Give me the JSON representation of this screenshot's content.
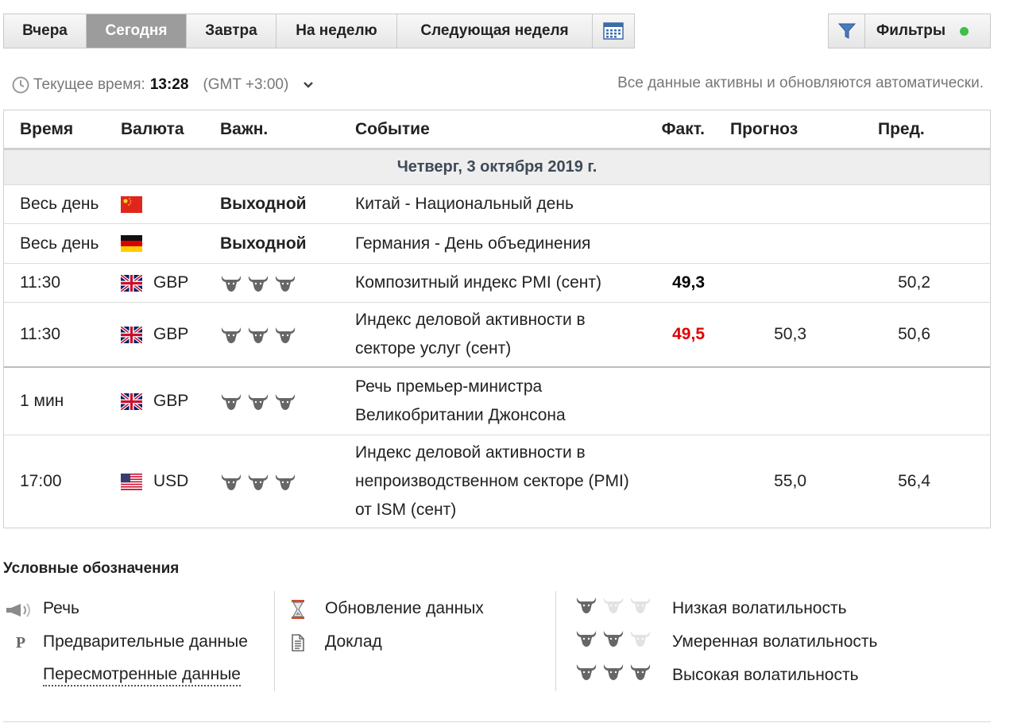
{
  "tabs": [
    {
      "label": "Вчера"
    },
    {
      "label": "Сегодня"
    },
    {
      "label": "Завтра"
    },
    {
      "label": "На неделю"
    },
    {
      "label": "Следующая неделя"
    }
  ],
  "active_tab": "Сегодня",
  "calendar_icon": "calendar-icon",
  "filters": {
    "label": "Фильтры",
    "icon": "funnel-icon",
    "status_color": "#3cc04a"
  },
  "current_time": {
    "label": "Текущее время:",
    "value": "13:28",
    "timezone": "(GMT +3:00)"
  },
  "auto_update_note": "Все данные активны и обновляются автоматически.",
  "table": {
    "headers": {
      "time": "Время",
      "currency": "Валюта",
      "importance": "Важн.",
      "event": "Событие",
      "actual": "Факт.",
      "forecast": "Прогноз",
      "previous": "Пред."
    },
    "day": "Четверг, 3 октября 2019 г.",
    "rows": [
      {
        "time": "Весь день",
        "flag": "china-flag",
        "currency": "",
        "importance_text": "Выходной",
        "event": "Китай - Национальный день",
        "actual": "",
        "forecast": "",
        "previous": ""
      },
      {
        "time": "Весь день",
        "flag": "germany-flag",
        "currency": "",
        "importance_text": "Выходной",
        "event": "Германия - День объединения",
        "actual": "",
        "forecast": "",
        "previous": ""
      },
      {
        "time": "11:30",
        "flag": "uk-flag",
        "currency": "GBP",
        "volatility": 3,
        "event": "Композитный индекс PMI (сент)",
        "actual": "49,3",
        "actual_color": "#000000",
        "forecast": "",
        "previous": "50,2"
      },
      {
        "time": "11:30",
        "flag": "uk-flag",
        "currency": "GBP",
        "volatility": 3,
        "event": "Индекс деловой активности в секторе услуг (сент)",
        "actual": "49,5",
        "actual_color": "#e00000",
        "forecast": "50,3",
        "previous": "50,6"
      },
      {
        "time": "1 мин",
        "flag": "uk-flag",
        "currency": "GBP",
        "volatility": 3,
        "event": "Речь премьер-министра Великобритании Джонсона",
        "actual": "",
        "forecast": "",
        "previous": ""
      },
      {
        "time": "17:00",
        "flag": "usa-flag",
        "currency": "USD",
        "volatility": 3,
        "event": "Индекс деловой активности в непроизводственном секторе (PMI) от ISM (сент)",
        "actual": "",
        "forecast": "55,0",
        "previous": "56,4"
      }
    ]
  },
  "legend": {
    "title": "Условные обозначения",
    "speech": "Речь",
    "preliminary": "Предварительные данные",
    "revised": "Пересмотренные данные",
    "data_update": "Обновление данных",
    "report": "Доклад",
    "low": "Низкая волатильность",
    "moderate": "Умеренная волатильность",
    "high": "Высокая волатильность",
    "preliminary_symbol": "P"
  }
}
